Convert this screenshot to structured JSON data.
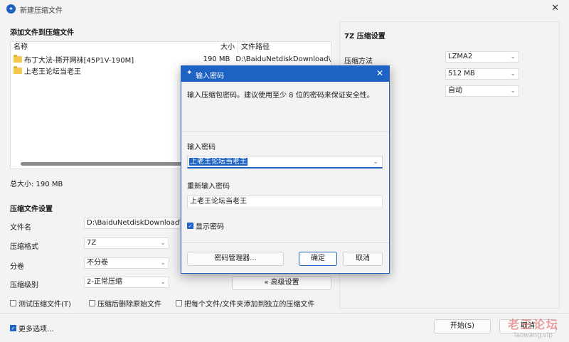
{
  "window": {
    "title": "新建压缩文件",
    "close_glyph": "✕"
  },
  "add_section": {
    "title": "添加文件到压缩文件",
    "columns": {
      "name": "名称",
      "size": "大小",
      "path": "文件路径"
    },
    "rows": [
      {
        "name": "布丁大法-撕开网袜[45P1V-190M]",
        "size": "190 MB",
        "path": "D:\\BaiduNetdiskDownload\\"
      },
      {
        "name": "上老王论坛当老王",
        "size": "",
        "path": ""
      }
    ],
    "total": "总大小: 190 MB"
  },
  "settings": {
    "title": "压缩文件设置",
    "filename_label": "文件名",
    "filename_value": "D:\\BaiduNetdiskDownload\\BD",
    "format_label": "压缩格式",
    "format_value": "7Z",
    "split_label": "分卷",
    "split_value": "不分卷",
    "level_label": "压缩级别",
    "level_value": "2-正常压缩",
    "advanced_button": "« 高级设置",
    "test_checkbox": "测试压缩文件(T)",
    "delete_checkbox": "压缩后删除原始文件",
    "separate_checkbox": "把每个文件/文件夹添加到独立的压缩文件"
  },
  "right_panel": {
    "title": "7Z 压缩设置",
    "method_label": "压缩方法",
    "method_value": "LZMA2",
    "dict_value": "512 MB",
    "auto_value": "自动"
  },
  "footer": {
    "more_options": "更多选项...",
    "start_button": "开始(S)",
    "cancel_button": "取消"
  },
  "dialog": {
    "title": "输入密码",
    "hint": "输入压缩包密码。建议使用至少 8 位的密码来保证安全性。",
    "password_label": "输入密码",
    "password_value": "上老王论坛当老王",
    "reenter_label": "重新输入密码",
    "reenter_value": "上老王论坛当老王",
    "show_password": "显示密码",
    "manager_button": "密码管理器...",
    "ok_button": "确定",
    "cancel_button": "取消"
  },
  "watermark": {
    "line1": "老王论坛",
    "line2": "laowang.vip"
  },
  "colors": {
    "accent": "#1e63c4"
  }
}
